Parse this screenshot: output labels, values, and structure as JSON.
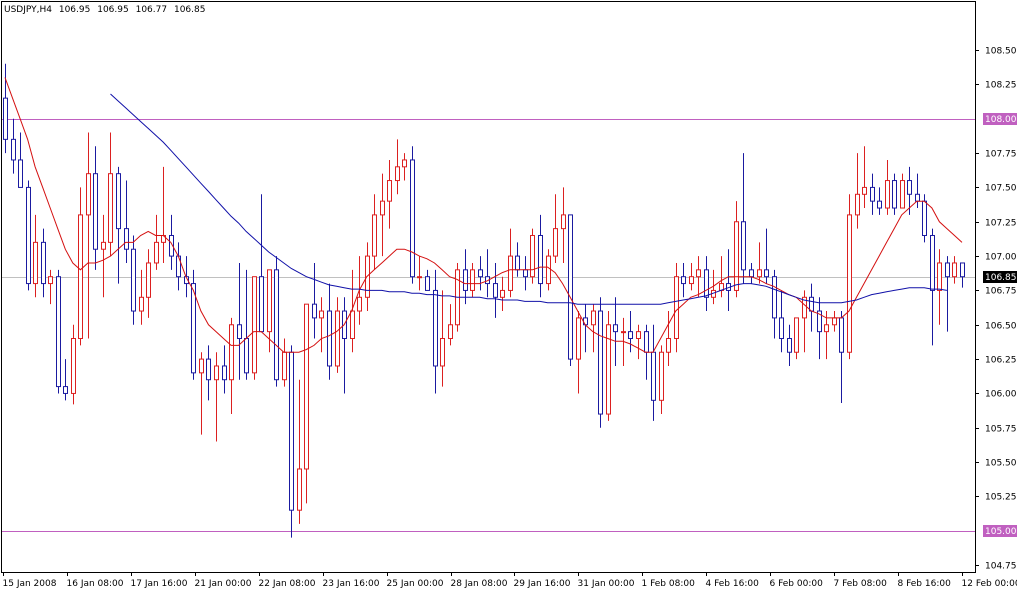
{
  "header": {
    "symbol": "USDJPY,H4",
    "open": "106.95",
    "high": "106.95",
    "low": "106.77",
    "close": "106.85"
  },
  "colors": {
    "bull": "#dc2020",
    "bear": "#1a1aa0",
    "ma_fast": "#d41010",
    "ma_slow": "#1010a8",
    "hline": "#c060c0",
    "price_line": "#c0c0c0",
    "price_label_bg": "#000000"
  },
  "chart_data": {
    "type": "candlestick",
    "symbol": "USDJPY",
    "timeframe": "H4",
    "ylim": [
      104.7,
      108.85
    ],
    "y_ticks": [
      "108.50",
      "108.25",
      "107.75",
      "107.50",
      "107.25",
      "107.00",
      "106.75",
      "106.50",
      "106.25",
      "106.00",
      "105.75",
      "105.50",
      "105.25",
      "104.75"
    ],
    "x_labels": [
      "15 Jan 2008",
      "16 Jan 08:00",
      "17 Jan 16:00",
      "21 Jan 00:00",
      "22 Jan 08:00",
      "23 Jan 16:00",
      "25 Jan 00:00",
      "28 Jan 08:00",
      "29 Jan 16:00",
      "31 Jan 00:00",
      "1 Feb 08:00",
      "4 Feb 16:00",
      "6 Feb 00:00",
      "7 Feb 08:00",
      "8 Feb 16:00",
      "12 Feb 00:00"
    ],
    "horizontal_levels": [
      {
        "label": "108.00",
        "value": 108.0
      },
      {
        "label": "105.00",
        "value": 105.0
      }
    ],
    "current_price": {
      "label": "106.85",
      "value": 106.85
    },
    "candles": [
      {
        "o": 108.15,
        "h": 108.4,
        "l": 107.75,
        "c": 107.85
      },
      {
        "o": 107.85,
        "h": 108.0,
        "l": 107.6,
        "c": 107.7
      },
      {
        "o": 107.7,
        "h": 107.9,
        "l": 107.55,
        "c": 107.5
      },
      {
        "o": 107.5,
        "h": 107.55,
        "l": 106.75,
        "c": 106.8
      },
      {
        "o": 106.8,
        "h": 107.3,
        "l": 106.7,
        "c": 107.1
      },
      {
        "o": 107.1,
        "h": 107.2,
        "l": 106.7,
        "c": 106.8
      },
      {
        "o": 106.8,
        "h": 106.9,
        "l": 106.65,
        "c": 106.85
      },
      {
        "o": 106.85,
        "h": 106.9,
        "l": 106.0,
        "c": 106.05
      },
      {
        "o": 106.05,
        "h": 106.25,
        "l": 105.95,
        "c": 106.0
      },
      {
        "o": 106.0,
        "h": 106.5,
        "l": 105.92,
        "c": 106.4
      },
      {
        "o": 106.4,
        "h": 107.5,
        "l": 106.35,
        "c": 107.3
      },
      {
        "o": 107.3,
        "h": 107.9,
        "l": 106.4,
        "c": 107.6
      },
      {
        "o": 107.6,
        "h": 107.8,
        "l": 106.9,
        "c": 107.05
      },
      {
        "o": 107.05,
        "h": 107.3,
        "l": 106.7,
        "c": 107.1
      },
      {
        "o": 107.1,
        "h": 107.9,
        "l": 107.0,
        "c": 107.6
      },
      {
        "o": 107.6,
        "h": 107.65,
        "l": 106.8,
        "c": 107.2
      },
      {
        "o": 107.2,
        "h": 107.55,
        "l": 106.95,
        "c": 107.05
      },
      {
        "o": 107.05,
        "h": 107.15,
        "l": 106.5,
        "c": 106.6
      },
      {
        "o": 106.6,
        "h": 106.9,
        "l": 106.5,
        "c": 106.7
      },
      {
        "o": 106.7,
        "h": 107.05,
        "l": 106.55,
        "c": 106.95
      },
      {
        "o": 106.95,
        "h": 107.3,
        "l": 106.9,
        "c": 107.1
      },
      {
        "o": 107.1,
        "h": 107.65,
        "l": 106.95,
        "c": 107.15
      },
      {
        "o": 107.15,
        "h": 107.3,
        "l": 106.9,
        "c": 107.0
      },
      {
        "o": 107.0,
        "h": 107.1,
        "l": 106.75,
        "c": 106.85
      },
      {
        "o": 106.85,
        "h": 107.0,
        "l": 106.7,
        "c": 106.8
      },
      {
        "o": 106.8,
        "h": 106.9,
        "l": 106.1,
        "c": 106.15
      },
      {
        "o": 106.15,
        "h": 106.3,
        "l": 105.7,
        "c": 106.25
      },
      {
        "o": 106.25,
        "h": 106.35,
        "l": 105.95,
        "c": 106.1
      },
      {
        "o": 106.1,
        "h": 106.3,
        "l": 105.65,
        "c": 106.2
      },
      {
        "o": 106.2,
        "h": 106.35,
        "l": 106.0,
        "c": 106.1
      },
      {
        "o": 106.1,
        "h": 106.55,
        "l": 105.85,
        "c": 106.5
      },
      {
        "o": 106.5,
        "h": 106.95,
        "l": 106.1,
        "c": 106.4
      },
      {
        "o": 106.4,
        "h": 106.9,
        "l": 106.1,
        "c": 106.15
      },
      {
        "o": 106.15,
        "h": 106.55,
        "l": 106.1,
        "c": 106.85
      },
      {
        "o": 106.85,
        "h": 107.45,
        "l": 106.6,
        "c": 106.45
      },
      {
        "o": 106.45,
        "h": 106.9,
        "l": 106.3,
        "c": 106.9
      },
      {
        "o": 106.9,
        "h": 107.0,
        "l": 106.05,
        "c": 106.1
      },
      {
        "o": 106.1,
        "h": 106.4,
        "l": 106.05,
        "c": 106.3
      },
      {
        "o": 106.3,
        "h": 106.35,
        "l": 104.95,
        "c": 105.15
      },
      {
        "o": 105.15,
        "h": 106.1,
        "l": 105.05,
        "c": 105.45
      },
      {
        "o": 105.45,
        "h": 106.65,
        "l": 105.2,
        "c": 106.65
      },
      {
        "o": 106.65,
        "h": 106.95,
        "l": 106.4,
        "c": 106.55
      },
      {
        "o": 106.55,
        "h": 106.7,
        "l": 106.3,
        "c": 106.6
      },
      {
        "o": 106.6,
        "h": 106.8,
        "l": 106.1,
        "c": 106.2
      },
      {
        "o": 106.2,
        "h": 106.7,
        "l": 106.15,
        "c": 106.6
      },
      {
        "o": 106.6,
        "h": 106.7,
        "l": 106.0,
        "c": 106.4
      },
      {
        "o": 106.4,
        "h": 106.9,
        "l": 106.3,
        "c": 106.6
      },
      {
        "o": 106.6,
        "h": 107.0,
        "l": 106.5,
        "c": 106.7
      },
      {
        "o": 106.7,
        "h": 107.1,
        "l": 106.6,
        "c": 107.0
      },
      {
        "o": 107.0,
        "h": 107.45,
        "l": 106.9,
        "c": 107.3
      },
      {
        "o": 107.3,
        "h": 107.6,
        "l": 107.0,
        "c": 107.4
      },
      {
        "o": 107.4,
        "h": 107.7,
        "l": 107.2,
        "c": 107.55
      },
      {
        "o": 107.55,
        "h": 107.85,
        "l": 107.45,
        "c": 107.65
      },
      {
        "o": 107.65,
        "h": 107.75,
        "l": 107.55,
        "c": 107.7
      },
      {
        "o": 107.7,
        "h": 107.8,
        "l": 106.8,
        "c": 106.85
      },
      {
        "o": 106.85,
        "h": 107.0,
        "l": 106.75,
        "c": 106.85
      },
      {
        "o": 106.85,
        "h": 106.9,
        "l": 106.75,
        "c": 106.75
      },
      {
        "o": 106.75,
        "h": 106.9,
        "l": 106.0,
        "c": 106.2
      },
      {
        "o": 106.2,
        "h": 106.75,
        "l": 106.05,
        "c": 106.4
      },
      {
        "o": 106.4,
        "h": 106.65,
        "l": 106.35,
        "c": 106.5
      },
      {
        "o": 106.5,
        "h": 106.95,
        "l": 106.45,
        "c": 106.9
      },
      {
        "o": 106.9,
        "h": 107.05,
        "l": 106.65,
        "c": 106.75
      },
      {
        "o": 106.75,
        "h": 106.95,
        "l": 106.7,
        "c": 106.9
      },
      {
        "o": 106.9,
        "h": 107.0,
        "l": 106.75,
        "c": 106.85
      },
      {
        "o": 106.85,
        "h": 107.05,
        "l": 106.7,
        "c": 106.8
      },
      {
        "o": 106.8,
        "h": 106.95,
        "l": 106.55,
        "c": 106.7
      },
      {
        "o": 106.7,
        "h": 106.85,
        "l": 106.6,
        "c": 106.75
      },
      {
        "o": 106.75,
        "h": 107.2,
        "l": 106.7,
        "c": 107.0
      },
      {
        "o": 107.0,
        "h": 107.1,
        "l": 106.85,
        "c": 106.9
      },
      {
        "o": 106.9,
        "h": 107.0,
        "l": 106.75,
        "c": 106.85
      },
      {
        "o": 106.85,
        "h": 107.2,
        "l": 106.8,
        "c": 107.15
      },
      {
        "o": 107.15,
        "h": 107.3,
        "l": 106.7,
        "c": 106.8
      },
      {
        "o": 106.8,
        "h": 107.05,
        "l": 106.75,
        "c": 107.0
      },
      {
        "o": 107.0,
        "h": 107.45,
        "l": 106.95,
        "c": 107.2
      },
      {
        "o": 107.2,
        "h": 107.5,
        "l": 106.95,
        "c": 107.3
      },
      {
        "o": 107.3,
        "h": 107.3,
        "l": 106.2,
        "c": 106.25
      },
      {
        "o": 106.25,
        "h": 106.6,
        "l": 106.0,
        "c": 106.55
      },
      {
        "o": 106.55,
        "h": 106.65,
        "l": 106.3,
        "c": 106.5
      },
      {
        "o": 106.5,
        "h": 106.65,
        "l": 106.3,
        "c": 106.6
      },
      {
        "o": 106.6,
        "h": 106.7,
        "l": 105.75,
        "c": 105.85
      },
      {
        "o": 105.85,
        "h": 106.6,
        "l": 105.8,
        "c": 106.5
      },
      {
        "o": 106.5,
        "h": 106.7,
        "l": 106.2,
        "c": 106.45
      },
      {
        "o": 106.45,
        "h": 106.55,
        "l": 106.2,
        "c": 106.45
      },
      {
        "o": 106.45,
        "h": 106.6,
        "l": 106.3,
        "c": 106.4
      },
      {
        "o": 106.4,
        "h": 106.5,
        "l": 106.25,
        "c": 106.45
      },
      {
        "o": 106.45,
        "h": 106.5,
        "l": 106.1,
        "c": 106.3
      },
      {
        "o": 106.3,
        "h": 106.5,
        "l": 105.8,
        "c": 105.95
      },
      {
        "o": 105.95,
        "h": 106.35,
        "l": 105.85,
        "c": 106.3
      },
      {
        "o": 106.3,
        "h": 106.6,
        "l": 106.2,
        "c": 106.4
      },
      {
        "o": 106.4,
        "h": 106.95,
        "l": 106.3,
        "c": 106.85
      },
      {
        "o": 106.85,
        "h": 106.95,
        "l": 106.7,
        "c": 106.8
      },
      {
        "o": 106.8,
        "h": 106.95,
        "l": 106.75,
        "c": 106.85
      },
      {
        "o": 106.85,
        "h": 107.0,
        "l": 106.7,
        "c": 106.9
      },
      {
        "o": 106.9,
        "h": 107.0,
        "l": 106.6,
        "c": 106.7
      },
      {
        "o": 106.7,
        "h": 106.9,
        "l": 106.65,
        "c": 106.75
      },
      {
        "o": 106.75,
        "h": 107.0,
        "l": 106.7,
        "c": 106.8
      },
      {
        "o": 106.8,
        "h": 107.05,
        "l": 106.6,
        "c": 106.75
      },
      {
        "o": 106.75,
        "h": 107.4,
        "l": 106.7,
        "c": 107.25
      },
      {
        "o": 107.25,
        "h": 107.75,
        "l": 106.8,
        "c": 106.9
      },
      {
        "o": 106.9,
        "h": 106.95,
        "l": 106.8,
        "c": 106.85
      },
      {
        "o": 106.85,
        "h": 107.1,
        "l": 106.8,
        "c": 106.9
      },
      {
        "o": 106.9,
        "h": 107.2,
        "l": 106.8,
        "c": 106.85
      },
      {
        "o": 106.85,
        "h": 106.9,
        "l": 106.4,
        "c": 106.55
      },
      {
        "o": 106.55,
        "h": 106.75,
        "l": 106.3,
        "c": 106.4
      },
      {
        "o": 106.4,
        "h": 106.5,
        "l": 106.2,
        "c": 106.3
      },
      {
        "o": 106.3,
        "h": 106.55,
        "l": 106.25,
        "c": 106.55
      },
      {
        "o": 106.55,
        "h": 106.75,
        "l": 106.3,
        "c": 106.7
      },
      {
        "o": 106.7,
        "h": 106.8,
        "l": 106.45,
        "c": 106.6
      },
      {
        "o": 106.6,
        "h": 106.7,
        "l": 106.25,
        "c": 106.45
      },
      {
        "o": 106.45,
        "h": 106.6,
        "l": 106.25,
        "c": 106.5
      },
      {
        "o": 106.5,
        "h": 106.6,
        "l": 106.45,
        "c": 106.55
      },
      {
        "o": 106.55,
        "h": 106.6,
        "l": 105.93,
        "c": 106.3
      },
      {
        "o": 106.3,
        "h": 107.45,
        "l": 106.25,
        "c": 107.3
      },
      {
        "o": 107.3,
        "h": 107.75,
        "l": 107.2,
        "c": 107.45
      },
      {
        "o": 107.45,
        "h": 107.8,
        "l": 107.35,
        "c": 107.5
      },
      {
        "o": 107.5,
        "h": 107.6,
        "l": 107.3,
        "c": 107.4
      },
      {
        "o": 107.4,
        "h": 107.5,
        "l": 107.3,
        "c": 107.35
      },
      {
        "o": 107.35,
        "h": 107.7,
        "l": 107.3,
        "c": 107.55
      },
      {
        "o": 107.55,
        "h": 107.6,
        "l": 107.3,
        "c": 107.35
      },
      {
        "o": 107.35,
        "h": 107.6,
        "l": 107.35,
        "c": 107.55
      },
      {
        "o": 107.55,
        "h": 107.65,
        "l": 107.3,
        "c": 107.45
      },
      {
        "o": 107.45,
        "h": 107.6,
        "l": 107.35,
        "c": 107.4
      },
      {
        "o": 107.4,
        "h": 107.45,
        "l": 107.1,
        "c": 107.15
      },
      {
        "o": 107.15,
        "h": 107.2,
        "l": 106.35,
        "c": 106.75
      },
      {
        "o": 106.75,
        "h": 107.05,
        "l": 106.5,
        "c": 106.95
      },
      {
        "o": 106.95,
        "h": 107.0,
        "l": 106.45,
        "c": 106.85
      },
      {
        "o": 106.85,
        "h": 107.0,
        "l": 106.8,
        "c": 106.95
      },
      {
        "o": 106.95,
        "h": 106.95,
        "l": 106.77,
        "c": 106.85
      }
    ],
    "ma_fast": [
      108.3,
      108.15,
      108.0,
      107.85,
      107.65,
      107.5,
      107.35,
      107.2,
      107.05,
      106.95,
      106.9,
      106.95,
      106.95,
      106.97,
      107.0,
      107.05,
      107.1,
      107.1,
      107.15,
      107.18,
      107.15,
      107.15,
      107.1,
      107.0,
      106.85,
      106.75,
      106.6,
      106.5,
      106.45,
      106.4,
      106.35,
      106.35,
      106.4,
      106.45,
      106.45,
      106.4,
      106.35,
      106.3,
      106.3,
      106.3,
      106.32,
      106.35,
      106.4,
      106.42,
      106.45,
      106.5,
      106.6,
      106.75,
      106.85,
      106.9,
      106.95,
      107.0,
      107.05,
      107.05,
      107.03,
      107.0,
      106.98,
      106.95,
      106.9,
      106.85,
      106.83,
      106.8,
      106.8,
      106.8,
      106.82,
      106.85,
      106.88,
      106.9,
      106.9,
      106.9,
      106.9,
      106.92,
      106.92,
      106.88,
      106.8,
      106.7,
      106.6,
      106.5,
      106.45,
      106.42,
      106.4,
      106.38,
      106.38,
      106.36,
      106.33,
      106.3,
      106.3,
      106.4,
      106.5,
      106.6,
      106.65,
      106.7,
      106.72,
      106.75,
      106.78,
      106.82,
      106.85,
      106.85,
      106.85,
      106.85,
      106.83,
      106.8,
      106.78,
      106.75,
      106.72,
      106.7,
      106.65,
      106.6,
      106.58,
      106.55,
      106.55,
      106.55,
      106.6,
      106.7,
      106.8,
      106.9,
      107.0,
      107.1,
      107.2,
      107.3,
      107.35,
      107.4,
      107.4,
      107.35,
      107.25,
      107.2,
      107.15,
      107.1
    ],
    "ma_slow": [
      108.6,
      108.58,
      108.56,
      108.54,
      108.52,
      108.5,
      108.47,
      108.44,
      108.41,
      108.38,
      108.34,
      108.3,
      108.26,
      108.22,
      108.18,
      108.13,
      108.08,
      108.03,
      107.98,
      107.93,
      107.88,
      107.83,
      107.77,
      107.71,
      107.65,
      107.59,
      107.53,
      107.47,
      107.41,
      107.35,
      107.29,
      107.24,
      107.18,
      107.13,
      107.08,
      107.03,
      106.99,
      106.95,
      106.91,
      106.88,
      106.85,
      106.83,
      106.81,
      106.79,
      106.78,
      106.77,
      106.76,
      106.76,
      106.75,
      106.75,
      106.75,
      106.74,
      106.74,
      106.74,
      106.73,
      106.73,
      106.72,
      106.72,
      106.71,
      106.71,
      106.7,
      106.7,
      106.7,
      106.7,
      106.69,
      106.69,
      106.68,
      106.68,
      106.68,
      106.67,
      106.67,
      106.67,
      106.66,
      106.66,
      106.66,
      106.66,
      106.65,
      106.65,
      106.65,
      106.65,
      106.65,
      106.65,
      106.65,
      106.65,
      106.65,
      106.65,
      106.65,
      106.65,
      106.66,
      106.67,
      106.68,
      106.69,
      106.7,
      106.71,
      106.73,
      106.75,
      106.77,
      106.79,
      106.8,
      106.8,
      106.79,
      106.78,
      106.76,
      106.74,
      106.72,
      106.7,
      106.68,
      106.67,
      106.66,
      106.66,
      106.66,
      106.66,
      106.67,
      106.68,
      106.7,
      106.72,
      106.73,
      106.74,
      106.75,
      106.76,
      106.77,
      106.77,
      106.77,
      106.76,
      106.76,
      106.75
    ]
  }
}
